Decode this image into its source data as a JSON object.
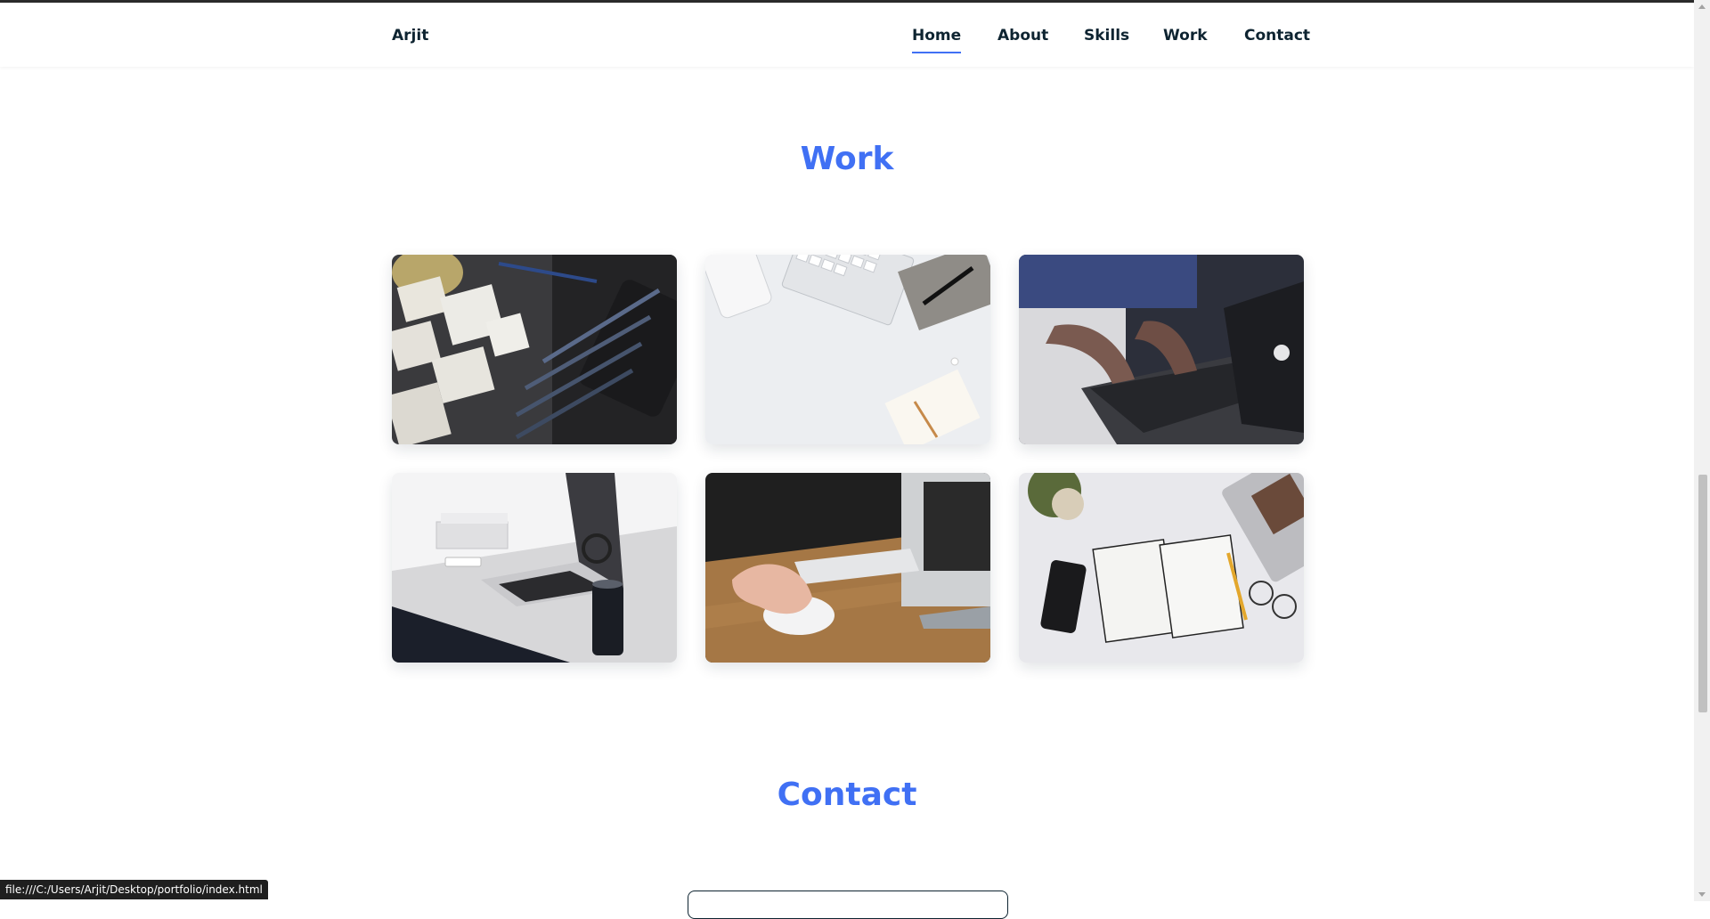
{
  "site": {
    "logo": "Arjit"
  },
  "nav": {
    "items": [
      {
        "label": "Home",
        "active": true
      },
      {
        "label": "About",
        "active": false
      },
      {
        "label": "Skills",
        "active": false
      },
      {
        "label": "Work",
        "active": false
      },
      {
        "label": "Contact",
        "active": false
      }
    ]
  },
  "work": {
    "title": "Work",
    "images": [
      {
        "name": "sketches-pencils-tablet-photo"
      },
      {
        "name": "keyboard-phone-notebook-photo"
      },
      {
        "name": "typing-on-laptop-photo"
      },
      {
        "name": "laptop-on-desk-photo"
      },
      {
        "name": "hand-on-mouse-photo"
      },
      {
        "name": "notebook-glasses-phone-photo"
      }
    ]
  },
  "contact": {
    "title": "Contact"
  },
  "status_bar": {
    "url": "file:///C:/Users/Arjit/Desktop/portfolio/index.html"
  },
  "colors": {
    "accent": "#4070f4",
    "text": "#0e2431"
  }
}
